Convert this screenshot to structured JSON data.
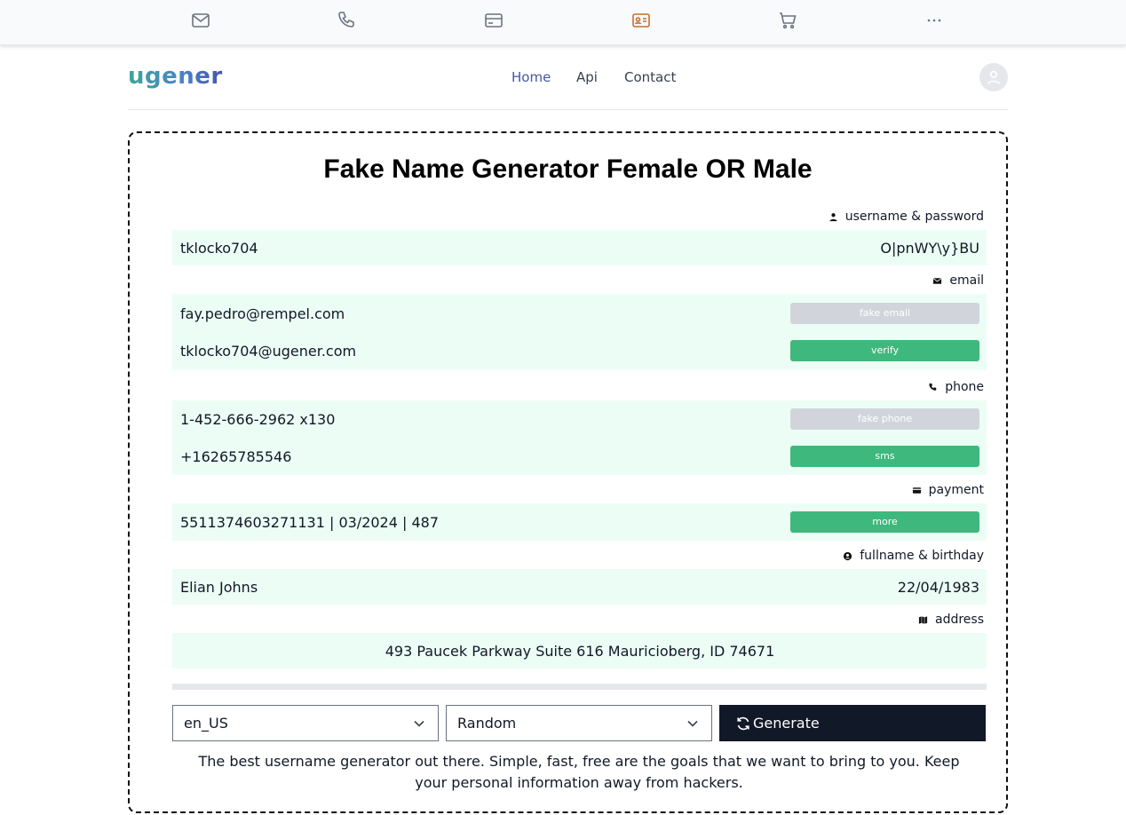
{
  "topbar": {
    "icons": [
      "mail-icon",
      "phone-icon",
      "credit-card-icon",
      "id-card-icon",
      "cart-icon",
      "more-icon"
    ],
    "active_color": "#c2702a"
  },
  "header": {
    "logo": "ugener",
    "nav": {
      "home": "Home",
      "api": "Api",
      "contact": "Contact"
    }
  },
  "card": {
    "title": "Fake Name Generator Female OR Male",
    "sections": {
      "credentials": {
        "label": "username & password",
        "username": "tklocko704",
        "password": "O|pnWY\\y}BU"
      },
      "email": {
        "label": "email",
        "fake_email": "fay.pedro@rempel.com",
        "fake_email_button": "fake email",
        "real_email": "tklocko704@ugener.com",
        "verify_button": "verify"
      },
      "phone": {
        "label": "phone",
        "fake_phone": "1-452-666-2962 x130",
        "fake_phone_button": "fake phone",
        "real_phone": "+16265785546",
        "sms_button": "sms"
      },
      "payment": {
        "label": "payment",
        "card": "5511374603271131 | 03/2024 | 487",
        "more_button": "more"
      },
      "identity": {
        "label": "fullname & birthday",
        "fullname": "Elian Johns",
        "birthday": "22/04/1983"
      },
      "address": {
        "label": "address",
        "value": "493 Paucek Parkway Suite 616 Mauricioberg, ID 74671"
      }
    },
    "controls": {
      "locale": "en_US",
      "gender": "Random",
      "generate": "Generate"
    },
    "tagline": "The best username generator out there. Simple, fast, free are the goals that we want to bring to you. Keep your personal information away from hackers."
  }
}
